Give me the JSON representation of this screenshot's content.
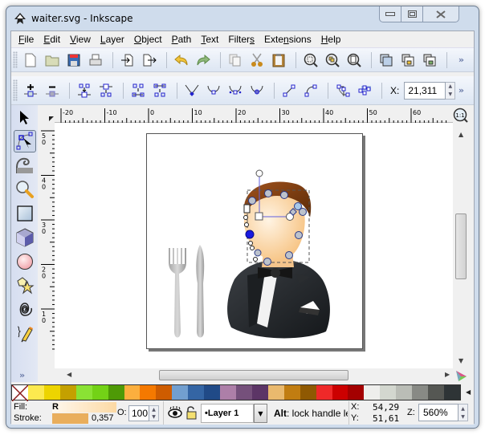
{
  "window": {
    "title": "waiter.svg - Inkscape",
    "controls": {
      "minimize": "minimize",
      "maximize": "maximize",
      "close": "close"
    }
  },
  "menubar": {
    "items": [
      {
        "label": "File",
        "mnemonic": "F"
      },
      {
        "label": "Edit",
        "mnemonic": "E"
      },
      {
        "label": "View",
        "mnemonic": "V"
      },
      {
        "label": "Layer",
        "mnemonic": "L"
      },
      {
        "label": "Object",
        "mnemonic": "O"
      },
      {
        "label": "Path",
        "mnemonic": "P"
      },
      {
        "label": "Text",
        "mnemonic": "T"
      },
      {
        "label": "Filters",
        "mnemonic": "s"
      },
      {
        "label": "Extensions",
        "mnemonic": "n"
      },
      {
        "label": "Help",
        "mnemonic": "H"
      }
    ]
  },
  "commands_bar": {
    "buttons": [
      "new-document-icon",
      "open-folder-icon",
      "save-icon",
      "print-icon",
      "import-icon",
      "export-icon",
      "undo-icon",
      "redo-icon",
      "copy-icon",
      "cut-icon",
      "paste-icon",
      "zoom-selection-icon",
      "zoom-drawing-icon",
      "zoom-page-icon",
      "duplicate-icon",
      "clone-icon",
      "unlink-clone-icon"
    ],
    "more": "»"
  },
  "node_controls": {
    "buttons": [
      "insert-node-icon",
      "delete-node-icon",
      "join-nodes-icon",
      "break-path-icon",
      "join-segment-icon",
      "delete-segment-icon",
      "node-cusp-icon",
      "node-smooth-icon",
      "node-symmetric-icon",
      "node-auto-icon",
      "segment-line-icon",
      "segment-curve-icon",
      "object-to-path-icon",
      "stroke-to-path-icon"
    ],
    "x_label": "X:",
    "x_value": "21,311",
    "more": "»"
  },
  "toolbox": {
    "tools": [
      "selector-tool-icon",
      "node-tool-icon",
      "tweak-tool-icon",
      "zoom-tool-icon",
      "rectangle-tool-icon",
      "3d-box-tool-icon",
      "ellipse-tool-icon",
      "star-tool-icon",
      "spiral-tool-icon",
      "pencil-tool-icon"
    ],
    "active": "node-tool-icon",
    "more": "»"
  },
  "rulers": {
    "horizontal_labels": [
      "-20",
      "-10",
      "0",
      "10",
      "20",
      "30",
      "40",
      "50",
      "60"
    ],
    "vertical_labels": [
      "50",
      "40",
      "30",
      "20",
      "10"
    ]
  },
  "canvas": {
    "drawing": "waiter illustration with fork and knife",
    "zoom_one_to_one": "1:1"
  },
  "palette": {
    "colors": [
      "#fce94f",
      "#edd400",
      "#c4a000",
      "#8ae234",
      "#73d216",
      "#4e9a06",
      "#fcaf3e",
      "#f57900",
      "#ce5c00",
      "#729fcf",
      "#3465a4",
      "#204a87",
      "#ad7fa8",
      "#75507b",
      "#5c3566",
      "#e9b96e",
      "#c17d11",
      "#8f5902",
      "#ef2929",
      "#cc0000",
      "#a40000",
      "#eeeeec",
      "#d3d7cf",
      "#babdb6",
      "#888a85",
      "#555753",
      "#2e3436"
    ]
  },
  "statusbar": {
    "fill_label": "Fill:",
    "fill_value": "R",
    "stroke_label": "Stroke:",
    "stroke_width": "0,357",
    "opacity_label": "O:",
    "opacity_value": "100",
    "layer_name": "•Layer 1",
    "message_bold": "Alt",
    "message": ": lock handle le.",
    "x_label": "X:",
    "x_value": "54,29",
    "y_label": "Y:",
    "y_value": "51,61",
    "zoom_label": "Z:",
    "zoom_value": "560%"
  }
}
